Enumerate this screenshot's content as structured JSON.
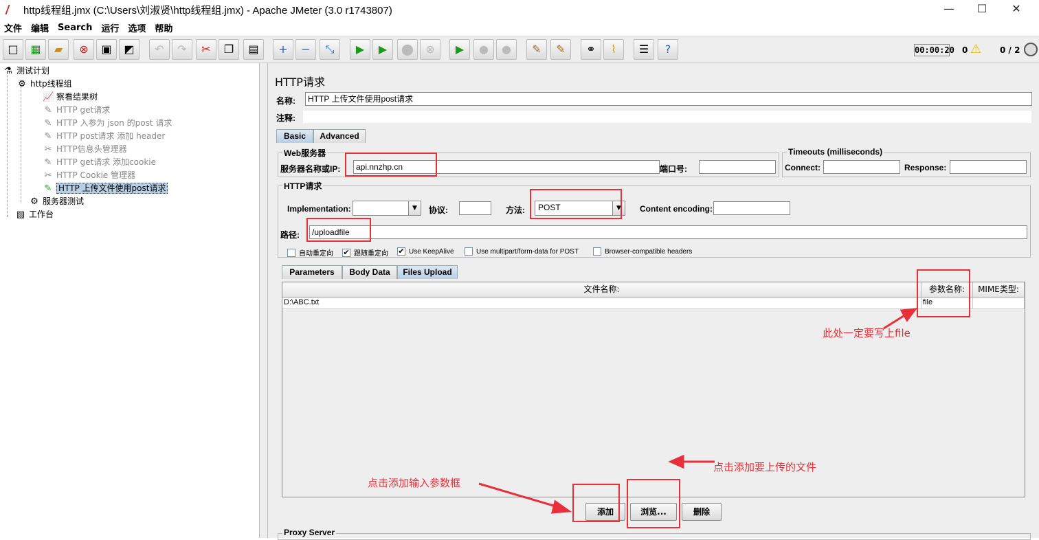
{
  "window": {
    "title": "http线程组.jmx (C:\\Users\\刘淑贤\\http线程组.jmx) - Apache JMeter (3.0 r1743807)",
    "minimize": "—",
    "maximize": "☐",
    "close": "✕"
  },
  "menu": [
    "文件",
    "编辑",
    "Search",
    "运行",
    "选项",
    "帮助"
  ],
  "toolbar": {
    "timer": "00:00:20",
    "warnings": "0",
    "threads": "0 / 2"
  },
  "tree": {
    "items": [
      {
        "label": "测试计划",
        "icon": "test-plan-icon",
        "glyph": "⚗"
      },
      {
        "label": "http线程组",
        "icon": "thread-group-icon",
        "glyph": "⚙"
      },
      {
        "label": "察看结果树",
        "icon": "result-tree-icon",
        "glyph": "📈"
      },
      {
        "label": "HTTP  get请求",
        "icon": "sampler-icon",
        "glyph": "✎"
      },
      {
        "label": "HTTP 入参为 json 的post 请求",
        "icon": "sampler-icon",
        "glyph": "✎"
      },
      {
        "label": "HTTP post请求 添加 header",
        "icon": "sampler-icon",
        "glyph": "✎"
      },
      {
        "label": "HTTP信息头管理器",
        "icon": "config-icon",
        "glyph": "✂"
      },
      {
        "label": "HTTP get请求 添加cookie",
        "icon": "sampler-icon",
        "glyph": "✎"
      },
      {
        "label": "HTTP Cookie 管理器",
        "icon": "config-icon",
        "glyph": "✂"
      },
      {
        "label": "HTTP  上传文件使用post请求",
        "icon": "sampler-icon",
        "glyph": "✎"
      },
      {
        "label": "服务器测试",
        "icon": "thread-group-icon",
        "glyph": "⚙"
      },
      {
        "label": "工作台",
        "icon": "workbench-icon",
        "glyph": "▧"
      }
    ]
  },
  "panel": {
    "title": "HTTP请求",
    "name_label": "名称:",
    "name_value": "HTTP  上传文件使用post请求",
    "comment_label": "注释:",
    "tabs": [
      "Basic",
      "Advanced"
    ],
    "web_server": {
      "legend": "Web服务器",
      "server_label": "服务器名称或IP:",
      "server_value": "api.nnzhp.cn",
      "port_label": "端口号:"
    },
    "timeouts": {
      "legend": "Timeouts (milliseconds)",
      "connect_label": "Connect:",
      "response_label": "Response:"
    },
    "http_request": {
      "legend": "HTTP请求",
      "impl_label": "Implementation:",
      "protocol_label": "协议:",
      "method_label": "方法:",
      "method_value": "POST",
      "encoding_label": "Content encoding:",
      "path_label": "路径:",
      "path_value": "/uploadfile"
    },
    "options": [
      {
        "label": "自动重定向",
        "checked": false
      },
      {
        "label": "跟随重定向",
        "checked": true
      },
      {
        "label": "Use KeepAlive",
        "checked": true
      },
      {
        "label": "Use multipart/form-data for POST",
        "checked": false
      },
      {
        "label": "Browser-compatible headers",
        "checked": false
      }
    ],
    "sub_tabs": [
      "Parameters",
      "Body Data",
      "Files Upload"
    ],
    "files_table": {
      "columns": [
        "文件名称:",
        "参数名称:",
        "MIME类型:"
      ],
      "rows": [
        [
          "D:\\ABC.txt",
          "file",
          ""
        ]
      ]
    },
    "buttons": {
      "add": "添加",
      "browse": "浏览...",
      "delete": "删除"
    },
    "proxy_legend": "Proxy Server"
  },
  "annotations": {
    "file_note": "此处一定要写上file",
    "browse_note": "点击添加要上传的文件",
    "add_note": "点击添加输入参数框"
  },
  "colors": {
    "annotation": "#e8303a",
    "selected": "#b8cfe5"
  }
}
